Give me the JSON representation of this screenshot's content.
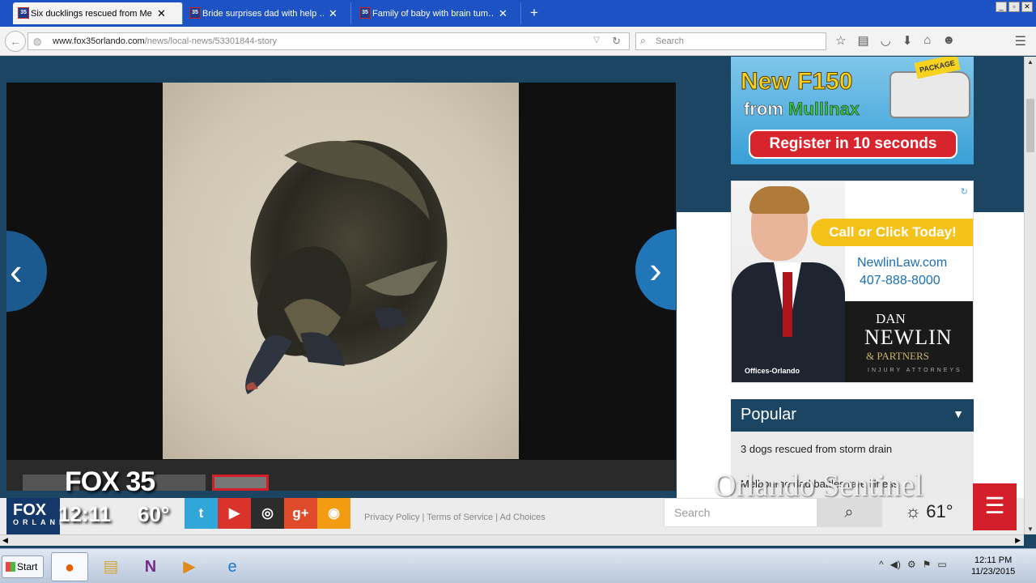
{
  "browser": {
    "tabs": [
      {
        "favicon": "35",
        "title": "Six ducklings rescued from Me…",
        "active": true
      },
      {
        "favicon": "35",
        "title": "Bride surprises dad with help …",
        "active": false
      },
      {
        "favicon": "35",
        "title": "Family of baby with brain tum…",
        "active": false
      }
    ],
    "new_tab": "+",
    "url_domain": "www.fox35orlando.com",
    "url_path": "/news/local-news/53301844-story",
    "search_placeholder": "Search"
  },
  "icons": {
    "back": "back-arrow-icon",
    "globe": "globe-icon",
    "reload": "reload-icon",
    "search": "magnifier-icon",
    "bookmark": "star-icon",
    "reader": "clipboard-icon",
    "pocket": "pocket-icon",
    "download": "download-arrow-icon",
    "home": "home-icon",
    "chat": "chat-icon",
    "menu": "hamburger-icon"
  },
  "gallery": {
    "prev": "‹",
    "next": "›"
  },
  "ads": {
    "truck": {
      "line1": "New F150",
      "line2_prefix": "from",
      "line2_brand": "Mullinax",
      "cta": "Register in 10 seconds",
      "badge": "PACKAGE"
    },
    "law": {
      "call": "Call or Click Today!",
      "site": "NewlinLaw.com",
      "phone": "407-888-8000",
      "name_first": "DAN",
      "name_last": "NEWLIN",
      "partners": "& PARTNERS",
      "tagline": "INJURY ATTORNEYS",
      "offices": "Offices-Orlando"
    }
  },
  "popular": {
    "title": "Popular",
    "items": [
      "3 dogs rescued from storm drain",
      "Melbourne dad battles rare illness"
    ]
  },
  "footer": {
    "logo": "FOX",
    "logo_sub": "ORLANDO",
    "social": [
      "t",
      "▶",
      "◎",
      "g+",
      "◉"
    ],
    "links": "Privacy Policy | Terms of Service | Ad Choices",
    "search_placeholder": "Search",
    "weather": "61°"
  },
  "broadcast": {
    "bug": "FOX 35",
    "time": "12:11",
    "temp": "60°",
    "watermark": "Orlando Sentinel"
  },
  "taskbar": {
    "start": "Start",
    "time": "12:11 PM",
    "date": "11/23/2015"
  },
  "colors": {
    "page_bg": "#1b4563",
    "accent_red": "#d21f2a",
    "accent_blue": "#2176b8",
    "social": [
      "#31a6d9",
      "#d9332b",
      "#2c2c2c",
      "#e04b2c",
      "#f39c12"
    ]
  }
}
